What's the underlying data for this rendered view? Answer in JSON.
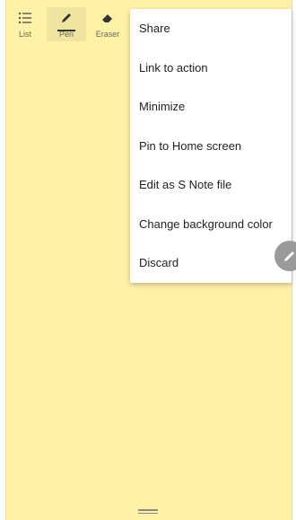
{
  "toolbar": {
    "tools": [
      {
        "label": "List",
        "icon": "list-icon"
      },
      {
        "label": "Pen",
        "icon": "pen-icon"
      },
      {
        "label": "Eraser",
        "icon": "eraser-icon"
      }
    ]
  },
  "menu": {
    "items": [
      {
        "label": "Share"
      },
      {
        "label": "Link to action"
      },
      {
        "label": "Minimize"
      },
      {
        "label": "Pin to Home screen"
      },
      {
        "label": "Edit as S Note file"
      },
      {
        "label": "Change background color"
      },
      {
        "label": "Discard"
      }
    ]
  },
  "fab": {
    "icon": "pencil-icon"
  },
  "colors": {
    "note_background": "#fff1a6",
    "menu_background": "#ffffff"
  }
}
